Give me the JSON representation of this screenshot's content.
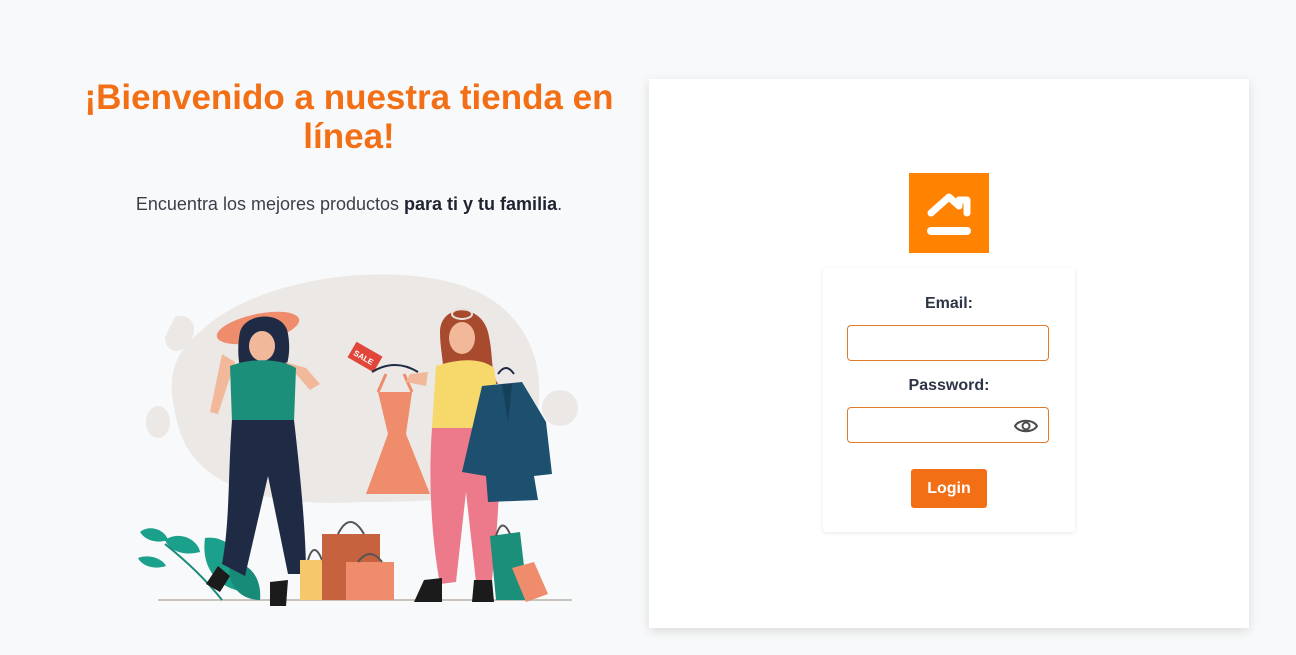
{
  "welcome": {
    "title": "¡Bienvenido a nuestra tienda en línea!",
    "subtitle_prefix": "Encuentra los mejores productos ",
    "subtitle_bold": "para ti y tu familia",
    "subtitle_suffix": "."
  },
  "illustration": {
    "sale_tag": "SALE"
  },
  "login": {
    "logo_icon": "home-roof-icon",
    "email_label": "Email:",
    "email_value": "",
    "password_label": "Password:",
    "password_value": "",
    "show_password_icon": "eye-icon",
    "login_button": "Login"
  },
  "colors": {
    "accent": "#f36f16",
    "logo_bg": "#ff8201",
    "background": "#f8f9fa"
  }
}
